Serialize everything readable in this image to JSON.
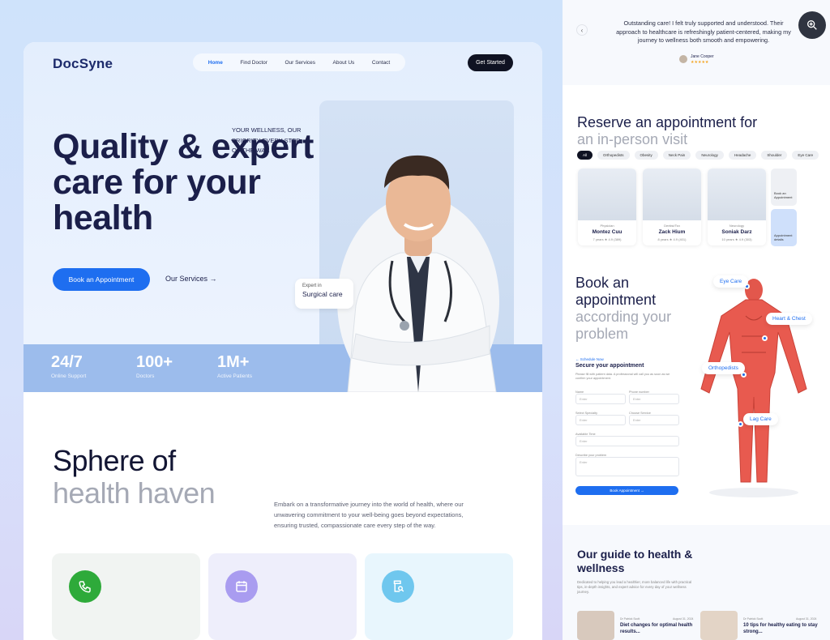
{
  "brand": {
    "logo": "DocSyne",
    "accent": "#1e6ef0",
    "dark": "#0f1222"
  },
  "nav": {
    "items": [
      "Home",
      "Find Doctor",
      "Our Services",
      "About Us",
      "Contact"
    ],
    "active": "Home",
    "cta": "Get Started"
  },
  "hero": {
    "title": "Quality & expert care for your health",
    "tagline": "Your wellness, our priority every step of the way.",
    "book_button": "Book an Appointment",
    "services_link": "Our Services",
    "badge_small": "Expert in",
    "badge_big": "Surgical care"
  },
  "stats": [
    {
      "value": "24/7",
      "label": "Online Support"
    },
    {
      "value": "100+",
      "label": "Doctors"
    },
    {
      "value": "1M+",
      "label": "Active Patients"
    }
  ],
  "sphere": {
    "title_dark": "Sphere of",
    "title_grey": "health haven",
    "description": "Embark on a transformative journey into the world of health, where our unwavering commitment to your well-being goes beyond expectations, ensuring trusted, compassionate care every step of the way.",
    "cards": [
      {
        "icon": "phone-icon",
        "bg": "#f1f4f2",
        "icon_bg": "#2eaa3a"
      },
      {
        "icon": "calendar-icon",
        "bg": "#eeeefb",
        "icon_bg": "#a99cf0"
      },
      {
        "icon": "medicine-search-icon",
        "bg": "#e8f6fd",
        "icon_bg": "#6fc7ee"
      }
    ]
  },
  "testimonial": {
    "quote": "Outstanding care! I felt truly supported and understood. Their approach to healthcare is refreshingly patient-centered, making my journey to wellness both smooth and empowering.",
    "author": "Jane Cooper",
    "stars": "★★★★★"
  },
  "reserve": {
    "title_dark": "Reserve an appointment for",
    "title_grey": "an in-person visit",
    "filters": [
      "All",
      "Orthopedists",
      "Obesity",
      "Neck Pain",
      "Neurology",
      "Headache",
      "Shoulder",
      "Eye Care"
    ],
    "active_filter": "All",
    "doctors": [
      {
        "specialty": "Physician",
        "name": "Montez Cuu",
        "years": "7 years",
        "rating": "4.9 (389)"
      },
      {
        "specialty": "Dentist/Tsn",
        "name": "Zack Hium",
        "years": "8 years",
        "rating": "4.9 (401)"
      },
      {
        "specialty": "Neurology",
        "name": "Soniak Darz",
        "years": "10 years",
        "rating": "4.9 (303)"
      }
    ],
    "side_cards": [
      "Book an Appointment",
      "Appointment details"
    ]
  },
  "book_problem": {
    "title_dark": "Book an appointment",
    "title_grey": "according your problem",
    "schedule_link": "← Schedule Now",
    "form_title": "Secure your appointment",
    "form_desc": "Please fill with patient data. A professional will call you as soon as we confirm your appointment.",
    "fields": [
      {
        "label": "Name",
        "placeholder": "Enter"
      },
      {
        "label": "Phone number",
        "placeholder": "Enter"
      },
      {
        "label": "Select Specialty",
        "placeholder": "Enter"
      },
      {
        "label": "Choose Service",
        "placeholder": "Enter"
      },
      {
        "label": "Available Time",
        "placeholder": "Enter"
      },
      {
        "label": "Describe your problem",
        "placeholder": "Enter"
      }
    ],
    "submit": "Book Appointment →",
    "body_tags": [
      "Eye Care",
      "Heart & Chest",
      "Orthopedists",
      "Lag Care"
    ]
  },
  "guide": {
    "title": "Our guide to health & wellness",
    "description": "Dedicated to helping you lead a healthier, more balanced life with practical tips, in-depth insights, and expert advice for every day of your wellness journey.",
    "posts": [
      {
        "tag": "Dr Patrick Scott",
        "date": "August 31, 2024",
        "title": "Diet changes for optimal health results..."
      },
      {
        "tag": "Dr Patrick Scott",
        "date": "August 31, 2024",
        "title": "10 tips for healthy eating to stay strong..."
      }
    ]
  }
}
